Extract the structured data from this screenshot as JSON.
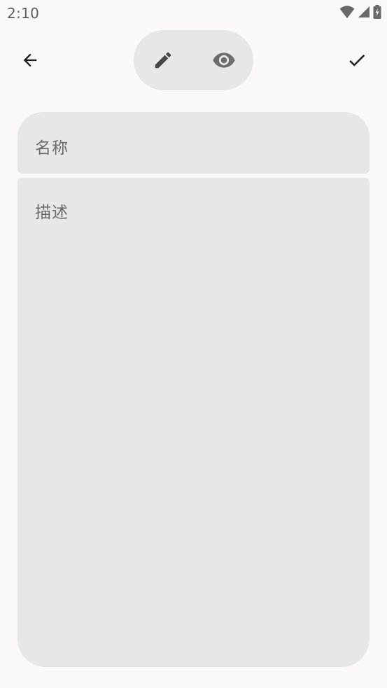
{
  "status_bar": {
    "time": "2:10",
    "icons": [
      "wifi-icon",
      "signal-icon",
      "battery-charging-icon"
    ]
  },
  "app_bar": {
    "back_icon": "arrow-back-icon",
    "confirm_icon": "check-icon",
    "mode_toggle": {
      "edit_icon": "pencil-icon",
      "preview_icon": "eye-icon"
    }
  },
  "form": {
    "name_placeholder": "名称",
    "name_value": "",
    "description_placeholder": "描述",
    "description_value": ""
  },
  "colors": {
    "background": "#fcf8f8",
    "field_background": "#e8e6e7",
    "placeholder_text": "#6e6b6d",
    "icon_dark": "#1d1b1c",
    "icon_muted": "#49454a"
  }
}
